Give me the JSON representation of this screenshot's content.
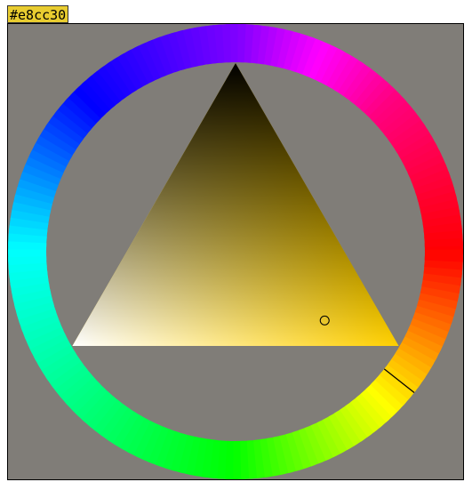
{
  "hex_value": "#e8cc30",
  "selected_color": "#e8cc30",
  "pure_hue_color": "#ffd000",
  "background_color": "#807d78",
  "hue_wheel": {
    "hue_degrees": 51
  },
  "sv_triangle": {
    "saturation": 0.8,
    "value": 0.91
  }
}
